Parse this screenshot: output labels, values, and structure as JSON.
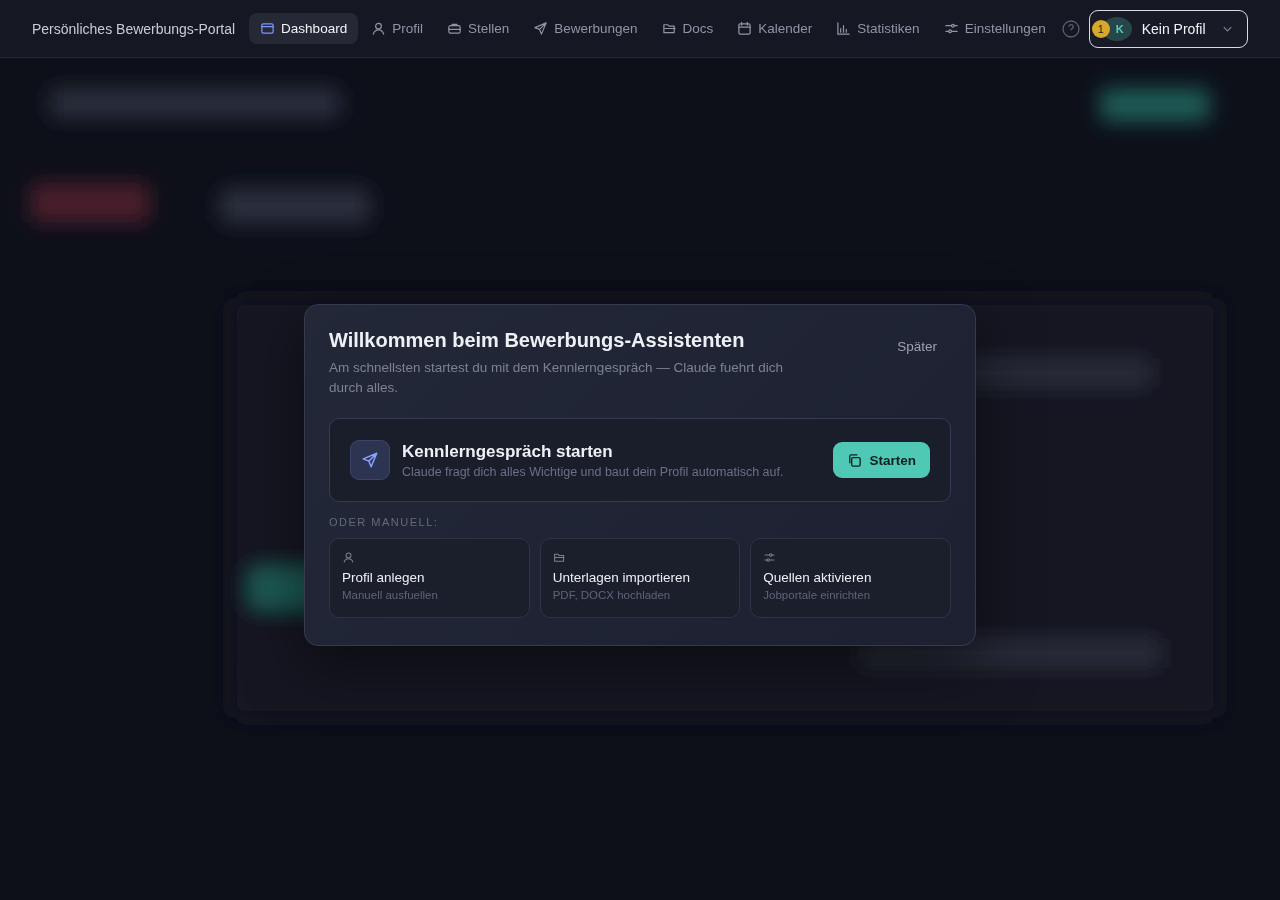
{
  "nav": {
    "title": "Persönliches Bewerbungs-Portal",
    "items": [
      {
        "label": "Dashboard",
        "selected": true
      },
      {
        "label": "Profil",
        "selected": false
      },
      {
        "label": "Stellen",
        "selected": false
      },
      {
        "label": "Bewerbungen",
        "selected": false
      },
      {
        "label": "Docs",
        "selected": false
      },
      {
        "label": "Kalender",
        "selected": false
      },
      {
        "label": "Statistiken",
        "selected": false
      },
      {
        "label": "Einstellungen",
        "selected": false
      }
    ],
    "profile": {
      "badge": "1",
      "avatar": "K",
      "label": "Kein Profil"
    }
  },
  "dialog": {
    "title": "Willkommen beim Bewerbungs-Assistenten",
    "subtitle": "Am schnellsten startest du mit dem Kennlerngespräch — Claude fuehrt dich durch alles.",
    "later": "Später",
    "primary": {
      "title": "Kennlerngespräch starten",
      "text": "Claude fragt dich alles Wichtige und baut dein Profil automatisch auf.",
      "button": "Starten"
    },
    "section": "ODER MANUELL:",
    "options": [
      {
        "title": "Profil anlegen",
        "text": "Manuell ausfuellen"
      },
      {
        "title": "Unterlagen importieren",
        "text": "PDF, DOCX hochladen"
      },
      {
        "title": "Quellen aktivieren",
        "text": "Jobportale einrichten"
      }
    ]
  }
}
